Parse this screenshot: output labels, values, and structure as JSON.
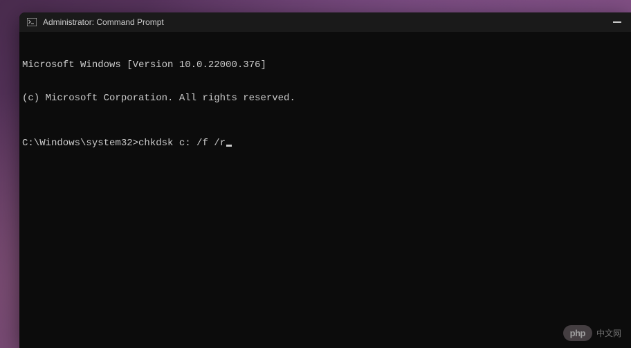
{
  "titlebar": {
    "title": "Administrator: Command Prompt"
  },
  "terminal": {
    "line1": "Microsoft Windows [Version 10.0.22000.376]",
    "line2": "(c) Microsoft Corporation. All rights reserved.",
    "prompt": "C:\\Windows\\system32>",
    "command": "chkdsk c: /f /r"
  },
  "watermark": {
    "logo": "php",
    "text": "中文网"
  }
}
